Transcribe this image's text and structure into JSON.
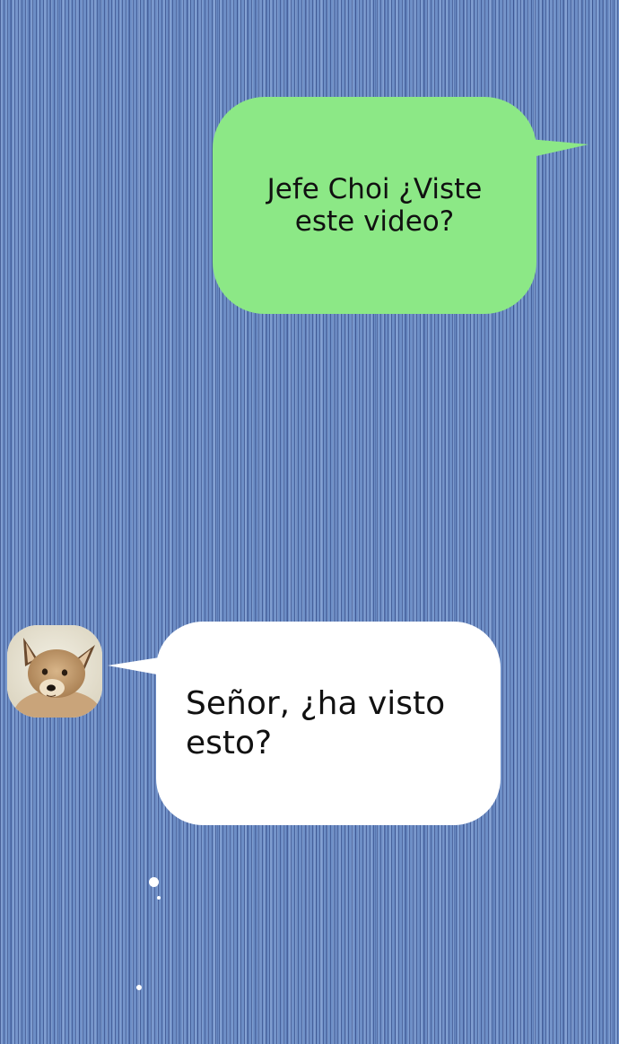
{
  "conversation": {
    "messages": [
      {
        "side": "sent",
        "text": "Jefe Choi ¿Viste este video?"
      },
      {
        "side": "received",
        "text": "Señor, ¿ha visto esto?"
      }
    ],
    "avatar_icon": "puppy-avatar-icon"
  },
  "colors": {
    "background": "#6d8ec6",
    "sent_bubble": "#8ce886",
    "received_bubble": "#ffffff",
    "text": "#111111"
  }
}
